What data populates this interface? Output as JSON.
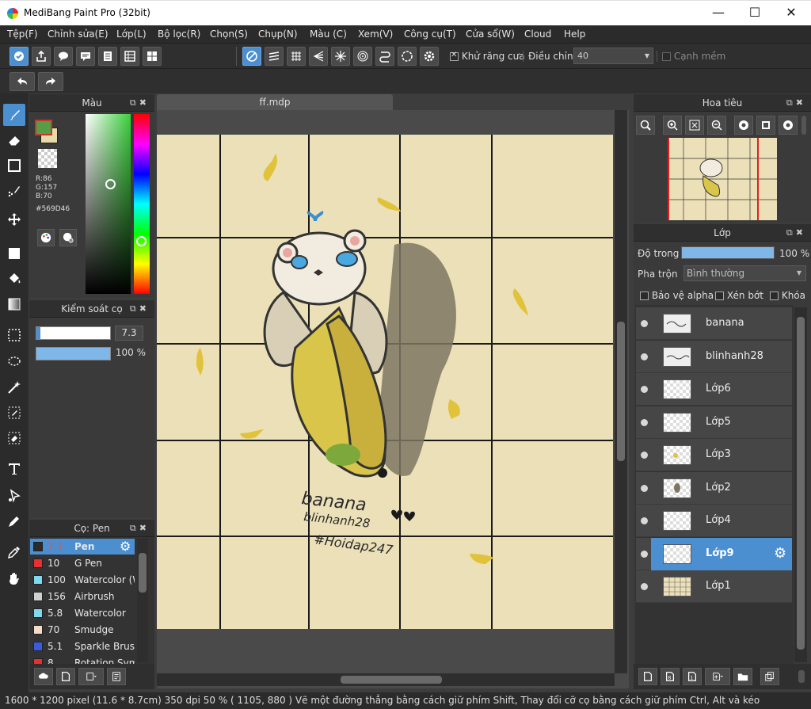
{
  "window": {
    "title": "MediBang Paint Pro (32bit)",
    "min": "—",
    "max": "☐",
    "close": "✕"
  },
  "menu": [
    "Tệp(F)",
    "Chỉnh sửa(E)",
    "Lớp(L)",
    "Bộ lọc(R)",
    "Chọn(S)",
    "Chụp(N)",
    "Màu (C)",
    "Xem(V)",
    "Công cụ(T)",
    "Cửa sổ(W)",
    "Cloud",
    "Help"
  ],
  "toolbar": {
    "antialias_label": "Khử răng cưa",
    "antialias_checked": true,
    "adjust_label": "Điều chỉnh",
    "adjust_value": "40",
    "edge_label": "Cạnh mềm",
    "edge_checked": false
  },
  "color_panel": {
    "title": "Màu",
    "r": "R:86",
    "g": "G:157",
    "b": "B:70",
    "hex": "#569D46",
    "primary": "#569D46",
    "secondary": "#E8D9A8"
  },
  "brush_control": {
    "title": "Kiểm soát cọ",
    "size": "7.3",
    "opacity": "100 %",
    "size_fraction": 0.05,
    "opacity_fraction": 1.0
  },
  "brush_panel": {
    "title": "Cọ: Pen",
    "brushes": [
      {
        "size": "7.3",
        "name": "Pen",
        "color": "#2a2a2a"
      },
      {
        "size": "10",
        "name": "G Pen",
        "color": "#e83030"
      },
      {
        "size": "100",
        "name": "Watercolor (W",
        "color": "#7fd8f0"
      },
      {
        "size": "156",
        "name": "Airbrush",
        "color": "#cfcfcf"
      },
      {
        "size": "5.8",
        "name": "Watercolor",
        "color": "#7fd8f0"
      },
      {
        "size": "70",
        "name": "Smudge",
        "color": "#f5dcc8"
      },
      {
        "size": "5.1",
        "name": "Sparkle Brush",
        "color": "#3b5bdb"
      },
      {
        "size": "8",
        "name": "Rotation Sym",
        "color": "#e83030"
      }
    ]
  },
  "canvas": {
    "tab": "ff.mdp",
    "text_main": "banana",
    "text_sub": "blinhanh28",
    "text_tag": "#Hoidap247"
  },
  "navigator": {
    "title": "Hoa tiêu"
  },
  "layer_panel": {
    "title": "Lớp",
    "opacity_label": "Độ trong",
    "opacity_value": "100 %",
    "blend_label": "Pha trộn",
    "blend_value": "Bình thường",
    "protect_alpha": "Bảo vệ alpha",
    "clip": "Xén bớt",
    "lock": "Khóa",
    "layers": [
      {
        "name": "banana",
        "selected": false
      },
      {
        "name": "blinhanh28",
        "selected": false
      },
      {
        "name": "Lớp6",
        "selected": false
      },
      {
        "name": "Lớp5",
        "selected": false
      },
      {
        "name": "Lớp3",
        "selected": false
      },
      {
        "name": "Lớp2",
        "selected": false
      },
      {
        "name": "Lớp4",
        "selected": false
      },
      {
        "name": "Lớp9",
        "selected": true
      },
      {
        "name": "Lớp1",
        "selected": false
      }
    ]
  },
  "status": {
    "text": "1600 * 1200 pixel   (11.6 * 8.7cm)   350 dpi   50 %   ( 1105, 880 )   Vẽ một đường thẳng bằng cách giữ phím Shift, Thay đổi cỡ cọ bằng cách giữ phím Ctrl, Alt và kéo"
  }
}
